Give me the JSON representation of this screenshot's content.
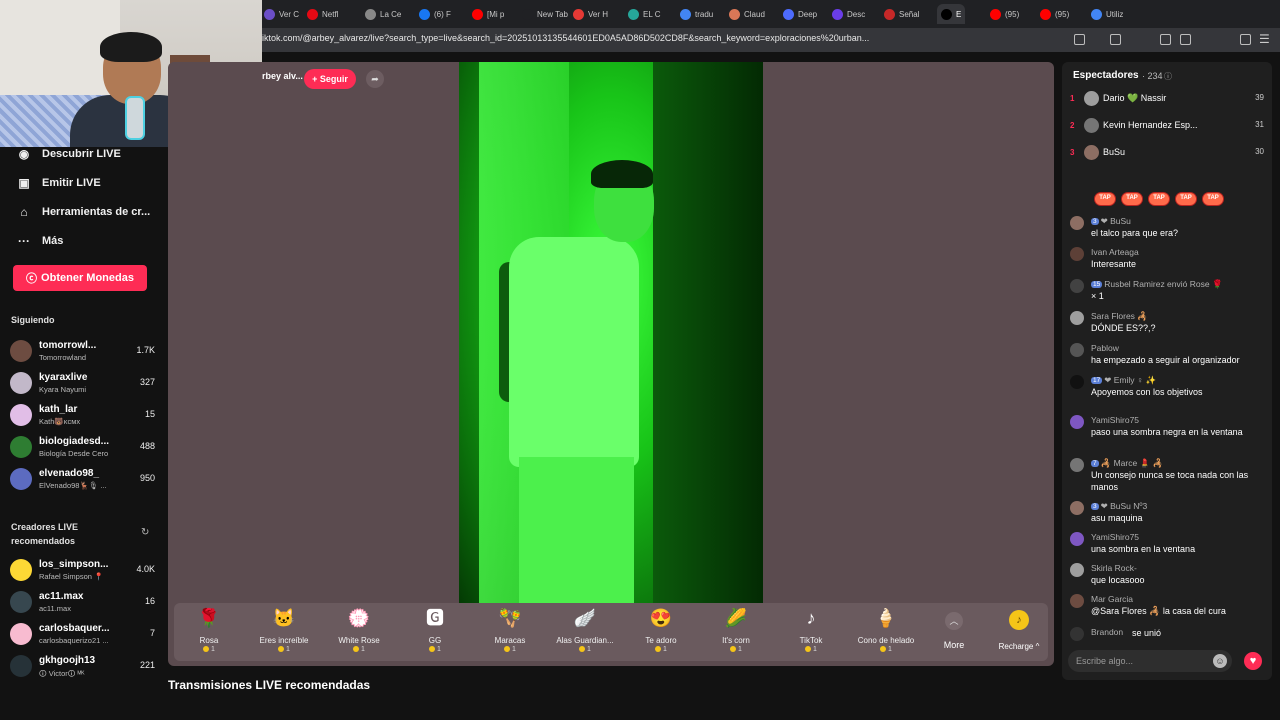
{
  "browser": {
    "tabs": [
      {
        "label": "Ver C",
        "color": "#6b4ec7"
      },
      {
        "label": "Netfl",
        "color": "#e50914"
      },
      {
        "label": "La Ce",
        "color": "#888888"
      },
      {
        "label": "(6) F",
        "color": "#1877f2"
      },
      {
        "label": "[Mi p",
        "color": "#ff0000"
      },
      {
        "label": "New Tab",
        "color": "#202124"
      },
      {
        "label": "Ver H",
        "color": "#e53935"
      },
      {
        "label": "EL C",
        "color": "#26a69a"
      },
      {
        "label": "tradu",
        "color": "#4285f4"
      },
      {
        "label": "Claud",
        "color": "#d97757"
      },
      {
        "label": "Deep",
        "color": "#4d6bfe"
      },
      {
        "label": "Desc",
        "color": "#6a3de8"
      },
      {
        "label": "Señal",
        "color": "#c62828"
      },
      {
        "label": "E",
        "color": "#000000"
      },
      {
        "label": "(95)",
        "color": "#ff0000"
      },
      {
        "label": "(95)",
        "color": "#ff0000"
      },
      {
        "label": "Utiliz",
        "color": "#4285f4"
      }
    ],
    "url": "iktok.com/@arbey_alvarez/live?search_type=live&search_id=20251013135544601ED0A5AD86D502CD8F&search_keyword=exploraciones%20urban..."
  },
  "sidebar": {
    "nav": [
      {
        "label": "Descubrir LIVE",
        "icon": "live-icon"
      },
      {
        "label": "Emitir LIVE",
        "icon": "camera-icon"
      },
      {
        "label": "Herramientas de cr...",
        "icon": "home-icon"
      },
      {
        "label": "Más",
        "icon": "more-icon"
      }
    ],
    "coins_button": "Obtener Monedas",
    "following_title": "Siguiendo",
    "following": [
      {
        "name": "tomorrowl...",
        "sub": "Tomorrowland",
        "count": "1.7K",
        "color": "#6d4c41"
      },
      {
        "name": "kyaraxlive",
        "sub": "Kyara Nayumi",
        "count": "327",
        "color": "#c2b8c9"
      },
      {
        "name": "kath_lar",
        "sub": "Kath🐻ᴋᴄᴍx",
        "count": "15",
        "color": "#e1bee7"
      },
      {
        "name": "biologiadesd...",
        "sub": "Biología Desde Cero",
        "count": "488",
        "color": "#2e7d32"
      },
      {
        "name": "elvenado98_",
        "sub": "ElVenado98🦌🎙 ...",
        "count": "950",
        "color": "#5c6bc0"
      }
    ],
    "recommended_title": "Creadores LIVE recomendados",
    "recommended": [
      {
        "name": "los_simpson...",
        "sub": "Rafael Simpson 📍",
        "count": "4.0K",
        "color": "#fdd835"
      },
      {
        "name": "ac11.max",
        "sub": "ac11.max",
        "count": "16",
        "color": "#37474f"
      },
      {
        "name": "carlosbaquer...",
        "sub": "carlosbaquerizo21 ...",
        "count": "7",
        "color": "#f8bbd0"
      },
      {
        "name": "gkhgoojh13",
        "sub": "🛈 Victor🛈 ᴹᴷ",
        "count": "221",
        "color": "#263238"
      }
    ]
  },
  "live": {
    "host": "rbey alv...",
    "follow": "+ Seguir",
    "share_icon": "share-icon"
  },
  "gifts": [
    {
      "name": "Rosa",
      "price": "1",
      "icon": "🌹"
    },
    {
      "name": "Eres increíble",
      "price": "1",
      "icon": "🐱"
    },
    {
      "name": "White Rose",
      "price": "1",
      "icon": "💮"
    },
    {
      "name": "GG",
      "price": "1",
      "icon": "🅶"
    },
    {
      "name": "Maracas",
      "price": "1",
      "icon": "🪇"
    },
    {
      "name": "Alas Guardian...",
      "price": "1",
      "icon": "🪽"
    },
    {
      "name": "Te adoro",
      "price": "1",
      "icon": "😍"
    },
    {
      "name": "It's corn",
      "price": "1",
      "icon": "🌽"
    },
    {
      "name": "TikTok",
      "price": "1",
      "icon": "♪"
    },
    {
      "name": "Cono de helado",
      "price": "1",
      "icon": "🍦"
    }
  ],
  "more_label": "More",
  "recharge_label": "Recharge ^",
  "recommended_streams_title": "Transmisiones LIVE recomendadas",
  "chat": {
    "viewers_title": "Espectadores",
    "viewers_count": "· 234",
    "top": [
      {
        "rank": "1",
        "name": "Dario 💚 Nassir",
        "score": "39",
        "color": "#9e9e9e"
      },
      {
        "rank": "2",
        "name": "Kevin Hernandez Esp...",
        "score": "31",
        "color": "#757575"
      },
      {
        "rank": "3",
        "name": "BuSu",
        "score": "30",
        "color": "#8d6e63"
      }
    ],
    "tap_label": "TAP",
    "messages": [
      {
        "badge": "3",
        "user": "❤ BuSu",
        "text": "el talco para que era?",
        "color": "#8d6e63"
      },
      {
        "badge": "",
        "user": "Ivan Arteaga",
        "text": "Interesante",
        "color": "#5d4037"
      },
      {
        "badge": "15",
        "user": "Rusbel Ramirez envió Rose 🌹",
        "text": "× 1",
        "color": "#424242"
      },
      {
        "badge": "",
        "user": "Sara Flores 🦂",
        "text": "DÓNDE ES??,?",
        "color": "#9e9e9e"
      },
      {
        "badge": "",
        "user": "Pablow",
        "text": "ha empezado a seguir al organizador",
        "color": "#555555"
      },
      {
        "badge": "17",
        "user": "❤ Emily ♀ ✨",
        "text": "Apoyemos con los objetivos",
        "color": "#111111"
      },
      {
        "badge": "",
        "user": "YamiShiro75",
        "text": "paso una sombra negra en la ventana",
        "color": "#7e57c2"
      },
      {
        "badge": "7",
        "user": "🦂 Marce 💄 🦂",
        "text": "Un consejo nunca se toca nada con las manos",
        "color": "#757575"
      },
      {
        "badge": "3",
        "user": "❤ BuSu Nº3",
        "text": "asu maquina",
        "color": "#8d6e63"
      },
      {
        "badge": "",
        "user": "YamiShiro75",
        "text": "una sombra en la ventana",
        "color": "#7e57c2"
      },
      {
        "badge": "",
        "user": "Skirla Rock-",
        "text": "que locasooo",
        "color": "#9e9e9e"
      },
      {
        "badge": "",
        "user": "Mar Garcia",
        "text": "@Sara Flores 🦂 la casa del cura",
        "color": "#6d4c41"
      },
      {
        "badge": "",
        "user": "Brandon",
        "text": "se unió",
        "color": "#333333"
      }
    ],
    "input_placeholder": "Escribe algo..."
  }
}
